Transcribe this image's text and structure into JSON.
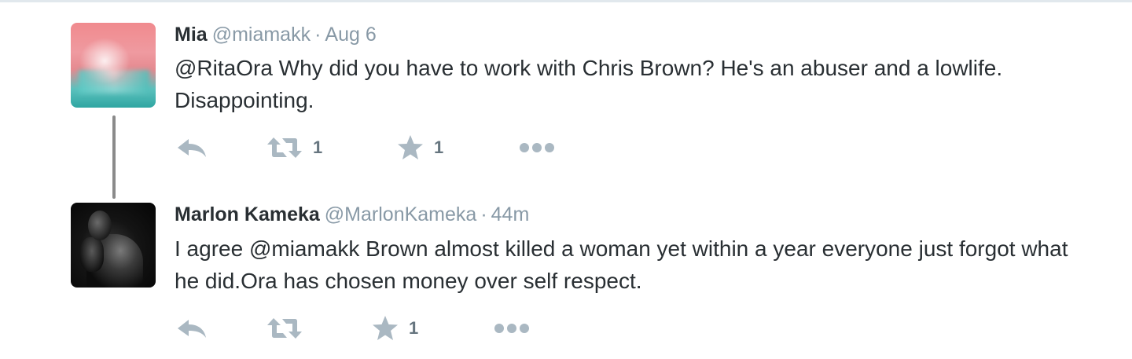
{
  "tweets": [
    {
      "name": "Mia",
      "handle": "@miamakk",
      "separator": "·",
      "time": "Aug 6",
      "text_mention": "@RitaOra",
      "text_body": " Why did you have to work with Chris Brown? He's an abuser and a lowlife. Disappointing.",
      "actions": {
        "reply_icon": "reply-icon",
        "retweet_icon": "retweet-icon",
        "retweet_count": "1",
        "favorite_icon": "star-icon",
        "favorite_count": "1",
        "more_icon": "more-dots-icon"
      }
    },
    {
      "name": "Marlon Kameka",
      "handle": "@MarlonKameka",
      "separator": "·",
      "time": "44m",
      "text_body": "I agree @miamakk Brown almost killed a woman yet within a year everyone just forgot what he did.Ora has chosen money over self respect.",
      "actions": {
        "reply_icon": "reply-icon",
        "retweet_icon": "retweet-icon",
        "retweet_count": "",
        "favorite_icon": "star-icon",
        "favorite_count": "1",
        "more_icon": "more-dots-icon"
      }
    }
  ],
  "colors": {
    "text": "#292f33",
    "muted": "#8899a6",
    "icon": "#aab8c2",
    "count": "#66757f",
    "connector": "#8a8a8a"
  }
}
